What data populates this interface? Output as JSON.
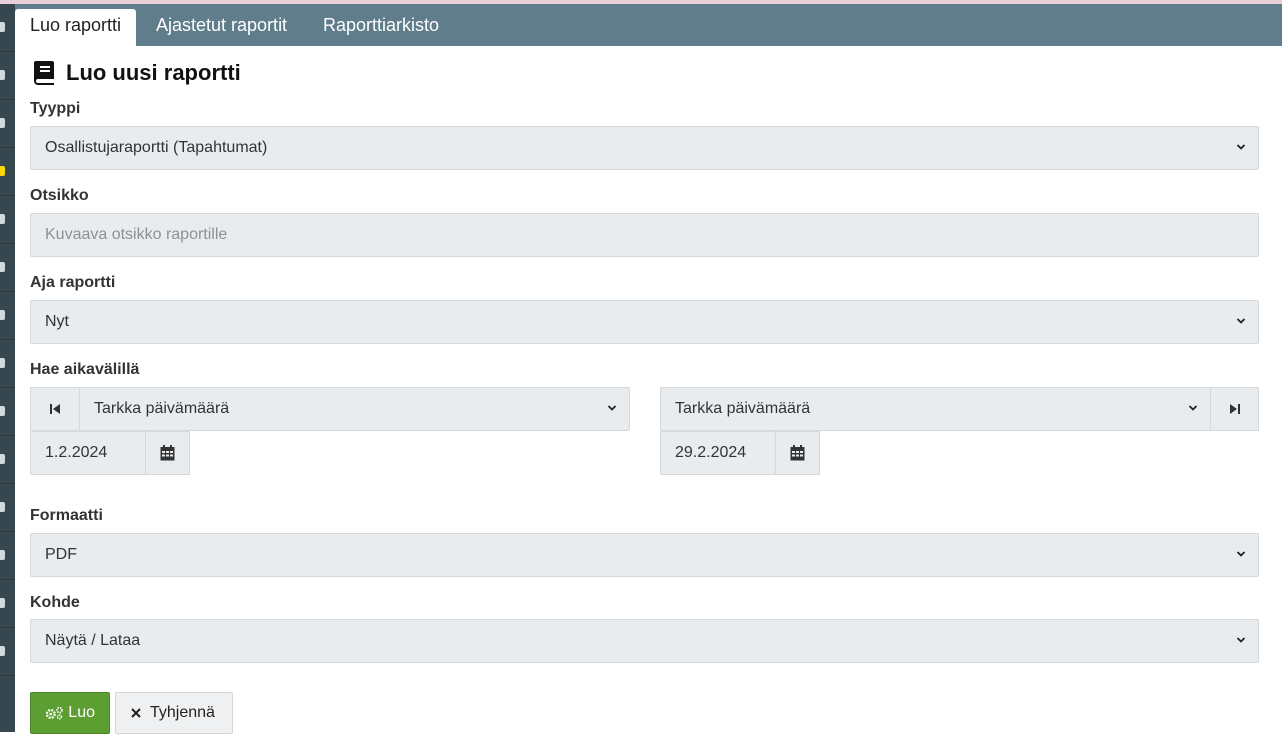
{
  "tabs": [
    {
      "label": "Luo raportti",
      "active": true
    },
    {
      "label": "Ajastetut raportit",
      "active": false
    },
    {
      "label": "Raporttiarkisto",
      "active": false
    }
  ],
  "page_title": "Luo uusi raportti",
  "form": {
    "type": {
      "label": "Tyyppi",
      "value": "Osallistujaraportti (Tapahtumat)"
    },
    "title": {
      "label": "Otsikko",
      "placeholder": "Kuvaava otsikko raportille"
    },
    "run": {
      "label": "Aja raportti",
      "value": "Nyt"
    },
    "range": {
      "label": "Hae aikavälillä",
      "start_mode": "Tarkka päivämäärä",
      "start_date": "1.2.2024",
      "end_mode": "Tarkka päivämäärä",
      "end_date": "29.2.2024"
    },
    "format": {
      "label": "Formaatti",
      "value": "PDF"
    },
    "target": {
      "label": "Kohde",
      "value": "Näytä / Lataa"
    }
  },
  "buttons": {
    "create": "Luo",
    "clear": "Tyhjennä"
  },
  "colors": {
    "tabbar": "#607d8b",
    "sidebar": "#37474f",
    "create_button": "#5c9e32",
    "field_bg": "#e9ecef"
  },
  "icons": {
    "title": "book-icon",
    "start": "skip-start-icon",
    "end": "skip-end-icon",
    "date": "calendar-icon",
    "create": "cogs-icon",
    "clear": "close-icon",
    "select": "chevron-down-icon"
  }
}
